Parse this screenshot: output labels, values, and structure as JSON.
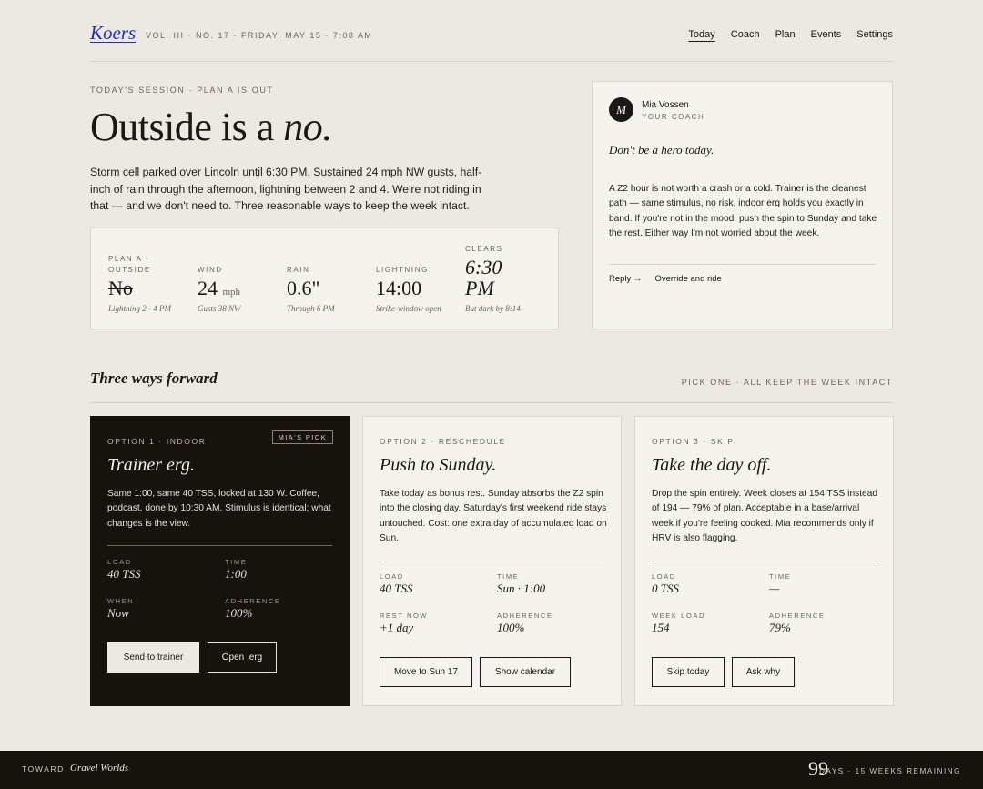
{
  "header": {
    "logo": "Koers",
    "issue": "VOL. III · NO. 17 · FRIDAY, MAY 15 · 7:08 AM",
    "nav": [
      "Today",
      "Coach",
      "Plan",
      "Events",
      "Settings"
    ]
  },
  "hero": {
    "eyebrow": "TODAY'S SESSION · PLAN A IS OUT",
    "title_main": "Outside is a ",
    "title_em": "no.",
    "body": "Storm cell parked over Lincoln until 6:30 PM. Sustained 24 mph NW gusts, half-inch of rain through the afternoon, lightning between 2 and 4. We're not riding in that — and we don't need to. Three reasonable ways to keep the week intact."
  },
  "stats": [
    {
      "label": "PLAN A · OUTSIDE",
      "value": "No",
      "unit": "",
      "sub": "Lightning 2 - 4 PM"
    },
    {
      "label": "WIND",
      "value": "24",
      "unit": "mph",
      "sub": "Gusts 38 NW"
    },
    {
      "label": "RAIN",
      "value": "0.6\"",
      "unit": "",
      "sub": "Through 6 PM"
    },
    {
      "label": "LIGHTNING",
      "value": "14:00",
      "unit": "",
      "sub": "Strike-window open"
    },
    {
      "label": "CLEARS",
      "value": "6:30 PM",
      "unit": "",
      "sub": "But dark by 8:14"
    }
  ],
  "coach": {
    "initial": "M",
    "name": "Mia Vossen",
    "role": "YOUR COACH",
    "quote": "Don't be a hero today.",
    "body": "A Z2 hour is not worth a crash or a cold. Trainer is the cleanest path — same stimulus, no risk, indoor erg holds you exactly in band. If you're not in the mood, push the spin to Sunday and take the rest. Either way I'm not worried about the week.",
    "reply": "Reply →",
    "override": "Override and ride"
  },
  "section": {
    "title": "Three ways forward",
    "note": "PICK ONE · ALL KEEP THE WEEK INTACT"
  },
  "options": [
    {
      "tag": "OPTION 1 · INDOOR",
      "badge": "MIA'S PICK",
      "title": "Trainer erg.",
      "desc": "Same 1:00, same 40 TSS, locked at 130 W. Coffee, podcast, done by 10:30 AM. Stimulus is identical; what changes is the view.",
      "metrics": [
        {
          "label": "LOAD",
          "value": "40 TSS"
        },
        {
          "label": "TIME",
          "value": "1:00"
        },
        {
          "label": "WHEN",
          "value": "Now"
        },
        {
          "label": "ADHERENCE",
          "value": "100%"
        }
      ],
      "buttons": [
        "Send to trainer",
        "Open .erg"
      ]
    },
    {
      "tag": "OPTION 2 · RESCHEDULE",
      "title": "Push to Sunday.",
      "desc": "Take today as bonus rest. Sunday absorbs the Z2 spin into the closing day. Saturday's first weekend ride stays untouched. Cost: one extra day of accumulated load on Sun.",
      "metrics": [
        {
          "label": "LOAD",
          "value": "40 TSS"
        },
        {
          "label": "TIME",
          "value": "Sun · 1:00"
        },
        {
          "label": "REST NOW",
          "value": "+1 day"
        },
        {
          "label": "ADHERENCE",
          "value": "100%"
        }
      ],
      "buttons": [
        "Move to Sun 17",
        "Show calendar"
      ]
    },
    {
      "tag": "OPTION 3 · SKIP",
      "title": "Take the day off.",
      "desc": "Drop the spin entirely. Week closes at 154 TSS instead of 194 — 79% of plan. Acceptable in a base/arrival week if you're feeling cooked. Mia recommends only if HRV is also flagging.",
      "metrics": [
        {
          "label": "LOAD",
          "value": "0 TSS"
        },
        {
          "label": "TIME",
          "value": "—"
        },
        {
          "label": "WEEK LOAD",
          "value": "154"
        },
        {
          "label": "ADHERENCE",
          "value": "79%"
        }
      ],
      "buttons": [
        "Skip today",
        "Ask why"
      ]
    }
  ],
  "footer": {
    "toward": "TOWARD",
    "goal": "Gravel Worlds",
    "days": "99",
    "remaining": "DAYS · 15 WEEKS REMAINING"
  },
  "colors": {
    "background": "#ECE9E2",
    "card": "#F5F3EE",
    "ink": "#1A1814",
    "dark": "#16130F",
    "logo": "#1F2BD6"
  }
}
